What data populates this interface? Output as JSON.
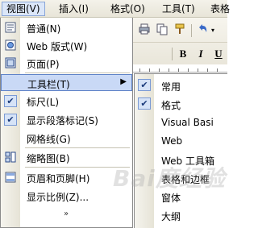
{
  "menubar": {
    "items": [
      {
        "label": "视图(V)"
      },
      {
        "label": "插入(I)"
      },
      {
        "label": "格式(O)"
      },
      {
        "label": "工具(T)"
      },
      {
        "label": "表格"
      }
    ]
  },
  "toolbar": {
    "bold": "B",
    "italic": "I",
    "underline": "U"
  },
  "view_menu": {
    "items": [
      {
        "label": "普通(N)",
        "icon": "normal-view-icon"
      },
      {
        "label": "Web 版式(W)",
        "icon": "web-layout-icon"
      },
      {
        "label": "页面(P)",
        "icon": "print-layout-icon"
      },
      {
        "label": "工具栏(T)",
        "submenu": true
      },
      {
        "label": "标尺(L)",
        "checked": true
      },
      {
        "label": "显示段落标记(S)",
        "checked": true
      },
      {
        "label": "网格线(G)"
      },
      {
        "label": "缩略图(B)",
        "icon": "thumbnails-icon"
      },
      {
        "label": "页眉和页脚(H)",
        "icon": "header-footer-icon"
      },
      {
        "label": "显示比例(Z)..."
      }
    ],
    "expand_glyph": "»"
  },
  "toolbars_submenu": {
    "items": [
      {
        "label": "常用",
        "checked": true
      },
      {
        "label": "格式",
        "checked": true
      },
      {
        "label": "Visual Basi"
      },
      {
        "label": "Web"
      },
      {
        "label": "Web 工具箱"
      },
      {
        "label": "表格和边框"
      },
      {
        "label": "窗体"
      },
      {
        "label": "大纲"
      }
    ]
  },
  "watermark": "Bai度经验"
}
